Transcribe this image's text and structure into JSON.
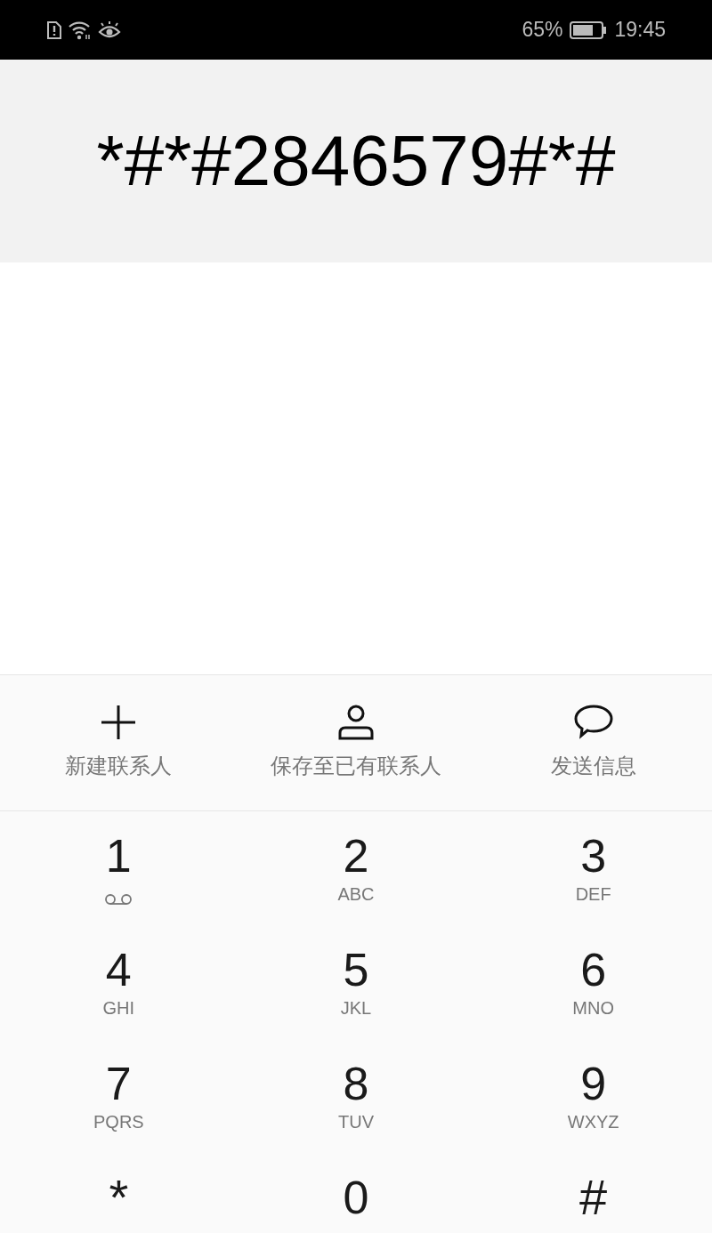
{
  "status_bar": {
    "battery": "65%",
    "time": "19:45"
  },
  "dialed_number": "*#*#2846579#*#",
  "actions": [
    {
      "kind": "add",
      "label": "新建联系人"
    },
    {
      "kind": "person",
      "label": "保存至已有联系人"
    },
    {
      "kind": "message",
      "label": "发送信息"
    }
  ],
  "keypad": [
    {
      "digit": "1",
      "kind": "voicemail"
    },
    {
      "digit": "2",
      "letters": "ABC"
    },
    {
      "digit": "3",
      "letters": "DEF"
    },
    {
      "digit": "4",
      "letters": "GHI"
    },
    {
      "digit": "5",
      "letters": "JKL"
    },
    {
      "digit": "6",
      "letters": "MNO"
    },
    {
      "digit": "7",
      "letters": "PQRS"
    },
    {
      "digit": "8",
      "letters": "TUV"
    },
    {
      "digit": "9",
      "letters": "WXYZ"
    },
    {
      "digit": "*",
      "kind": "symbol"
    },
    {
      "digit": "0"
    },
    {
      "digit": "#",
      "kind": "symbol"
    }
  ]
}
